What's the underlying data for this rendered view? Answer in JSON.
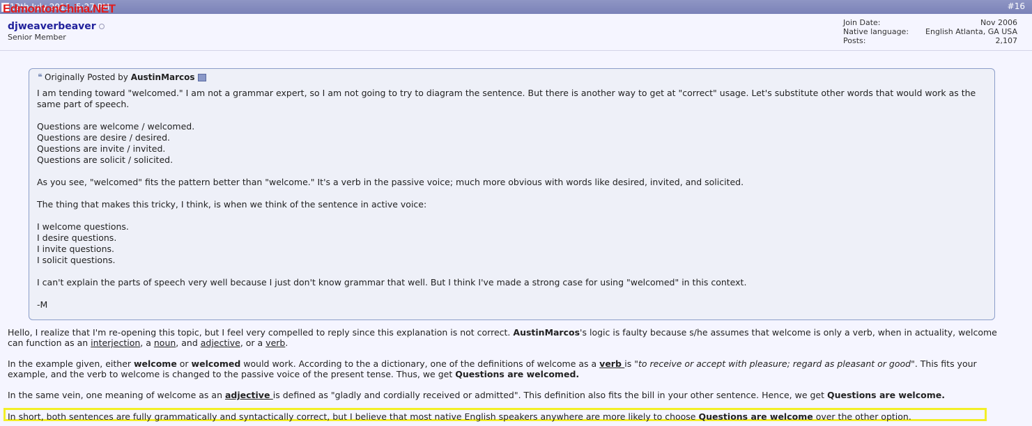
{
  "topbar": {
    "date": "12th July 2011, 5:27 PM",
    "post_number": "#16",
    "watermark": "EdmontonChina.NET"
  },
  "user": {
    "name": "djweaverbeaver",
    "title": "Senior Member",
    "info": [
      {
        "label": "Join Date:",
        "value": "Nov 2006"
      },
      {
        "label": "Native language:",
        "value": "English Atlanta, GA USA"
      },
      {
        "label": "Posts:",
        "value": "2,107"
      }
    ]
  },
  "quote": {
    "prefix": "Originally Posted by",
    "author": "AustinMarcos",
    "lines": [
      "I am tending toward \"welcomed.\" I am not a grammar expert, so I am not going to try to diagram the sentence. But there is another way to get at \"correct\" usage. Let's substitute other words that would work as the same part of speech.",
      "",
      "Questions are welcome / welcomed.",
      "Questions are desire / desired.",
      "Questions are invite / invited.",
      "Questions are solicit / solicited.",
      "",
      "As you see, \"welcomed\" fits the pattern better than \"welcome.\" It's a verb in the passive voice; much more obvious with words like desired, invited, and solicited.",
      "",
      "The thing that makes this tricky, I think, is when we think of the sentence in active voice:",
      "",
      "I welcome questions.",
      "I desire questions.",
      "I invite questions.",
      "I solicit questions.",
      "",
      "I can't explain the parts of speech very well because I just don't know grammar that well. But I think I've made a strong case for using \"welcomed\" in this context.",
      "",
      "-M"
    ]
  },
  "reply": {
    "p1": {
      "t1": "Hello, I realize that I'm re-opening this topic, but I feel very compelled to reply since this explanation is not correct. ",
      "b1": "AustinMarcos",
      "t2": "'s logic is faulty because s/he assumes that welcome is only a verb, when in actuality, welcome can function as an ",
      "l1": "interjection",
      "t3": ", a ",
      "l2": "noun",
      "t4": ", and ",
      "l3": "adjective",
      "t5": ", or a ",
      "l4": "verb",
      "t6": "."
    },
    "p2": {
      "t1": "In the example given, either ",
      "b1": "welcome",
      "t2": " or ",
      "b2": "welcomed",
      "t3": " would work. According to the a dictionary, one of the definitions of welcome as a ",
      "l1": "verb ",
      "t4": "is ",
      "i1": "\"to receive or accept with pleasure; regard as pleasant or good",
      "t5": "\". This fits your example, and the verb to welcome is changed to the passive voice of the present tense. Thus, we get ",
      "b3": "Questions are welcomed."
    },
    "p3": {
      "t1": "In the same vein, one meaning of welcome as an ",
      "l1": "adjective ",
      "t2": "is defined as \"gladly and cordially received or admitted\". This definition also fits the bill in your other sentence. Hence, we get ",
      "b1": "Questions are welcome."
    },
    "p4": {
      "t1": "In short, both sentences are fully grammatically and syntactically correct, but I believe that most native English speakers anywhere are more likely to choose ",
      "b1": "Questions are welcome",
      "t2": " over the other option."
    }
  },
  "colors": {
    "header_bar": "#7a82b8",
    "username": "#22229c",
    "quote_border": "#8b9dc9",
    "highlight": "#f2ef27",
    "watermark": "#e21b1b"
  }
}
